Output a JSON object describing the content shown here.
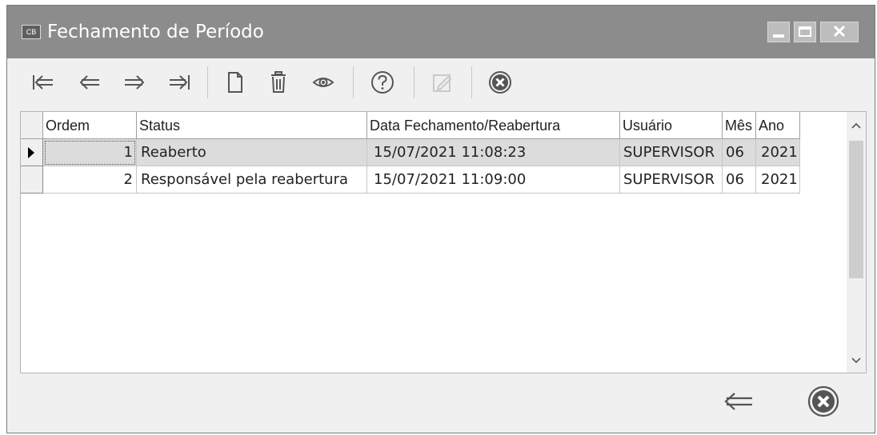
{
  "window": {
    "title": "Fechamento de Período",
    "icon_text": "CB",
    "controls": {
      "minimize": "minimize-icon",
      "maximize": "maximize-icon",
      "close_label": "✕"
    }
  },
  "toolbar": {
    "buttons": [
      {
        "name": "first-record-button",
        "icon": "first-arrow-icon",
        "glyph": "⇤",
        "enabled": true
      },
      {
        "name": "previous-record-button",
        "icon": "left-arrow-icon",
        "glyph": "⇐",
        "enabled": true
      },
      {
        "name": "next-record-button",
        "icon": "right-arrow-icon",
        "glyph": "⇒",
        "enabled": true
      },
      {
        "name": "last-record-button",
        "icon": "last-arrow-icon",
        "glyph": "⇥",
        "enabled": true
      },
      {
        "name": "new-record-button",
        "icon": "new-document-icon",
        "glyph": "",
        "enabled": true
      },
      {
        "name": "delete-record-button",
        "icon": "trash-icon",
        "glyph": "",
        "enabled": true
      },
      {
        "name": "view-record-button",
        "icon": "eye-icon",
        "glyph": "",
        "enabled": true
      },
      {
        "name": "help-button",
        "icon": "help-icon",
        "glyph": "?",
        "enabled": true
      },
      {
        "name": "edit-record-button",
        "icon": "edit-icon",
        "glyph": "",
        "enabled": false
      },
      {
        "name": "cancel-button",
        "icon": "cancel-icon",
        "glyph": "✖",
        "enabled": true
      }
    ]
  },
  "grid": {
    "columns": [
      "Ordem",
      "Status",
      "Data Fechamento/Reabertura",
      "Usuário",
      "Mês",
      "Ano"
    ],
    "rows": [
      {
        "ordem": "1",
        "status": "Reaberto",
        "data": "15/07/2021 11:08:23",
        "usuario": "SUPERVISOR",
        "mes": "06",
        "ano": "2021",
        "selected": true
      },
      {
        "ordem": "2",
        "status": "Responsável pela reabertura",
        "data": "15/07/2021 11:09:00",
        "usuario": "SUPERVISOR",
        "mes": "06",
        "ano": "2021",
        "selected": false
      }
    ],
    "scroll": {
      "up_arrow": "^",
      "down_arrow": "v"
    }
  },
  "bottom_bar": {
    "buttons": [
      {
        "name": "back-button",
        "icon": "back-arrow-icon",
        "glyph": "⇐"
      },
      {
        "name": "close-form-button",
        "icon": "cancel-icon",
        "glyph": "✖"
      }
    ]
  },
  "colors": {
    "titlebar": "#8c8c8c",
    "selected_row": "#dcdcdc",
    "icon": "#555555"
  }
}
